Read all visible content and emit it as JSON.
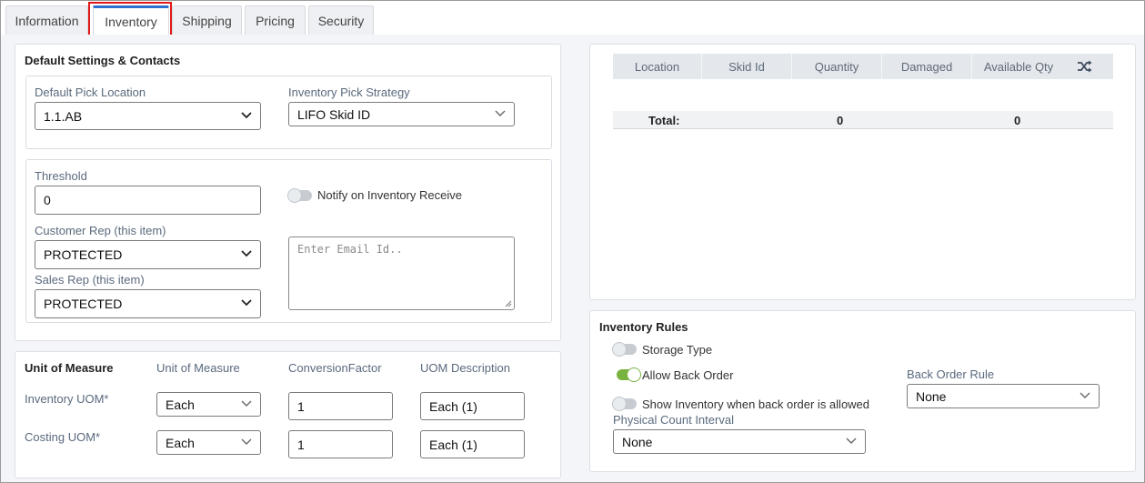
{
  "tabs": [
    {
      "label": "Information",
      "active": false
    },
    {
      "label": "Inventory",
      "active": true
    },
    {
      "label": "Shipping",
      "active": false
    },
    {
      "label": "Pricing",
      "active": false
    },
    {
      "label": "Security",
      "active": false
    }
  ],
  "defaults": {
    "title": "Default Settings & Contacts",
    "pick_location_label": "Default Pick Location",
    "pick_location_value": "1.1.AB",
    "pick_strategy_label": "Inventory Pick Strategy",
    "pick_strategy_value": "LIFO Skid ID",
    "threshold_label": "Threshold",
    "threshold_value": "0",
    "notify_label": "Notify on Inventory Receive",
    "notify_on": false,
    "customer_rep_label": "Customer Rep (this item)",
    "customer_rep_value": "PROTECTED",
    "sales_rep_label": "Sales Rep (this item)",
    "sales_rep_value": "PROTECTED",
    "email_placeholder": "Enter Email Id.."
  },
  "uom": {
    "title": "Unit of Measure",
    "col_unit": "Unit of Measure",
    "col_factor": "ConversionFactor",
    "col_desc": "UOM Description",
    "rows": [
      {
        "label": "Inventory UOM*",
        "unit": "Each",
        "factor": "1",
        "desc": "Each (1)"
      },
      {
        "label": "Costing UOM*",
        "unit": "Each",
        "factor": "1",
        "desc": "Each (1)"
      }
    ]
  },
  "stock_table": {
    "headers": [
      "Location",
      "Skid Id",
      "Quantity",
      "Damaged",
      "Available Qty"
    ],
    "shuffle_icon": "shuffle-icon",
    "total_label": "Total:",
    "total_quantity": "0",
    "total_available": "0"
  },
  "rules": {
    "title": "Inventory Rules",
    "storage_type_label": "Storage Type",
    "storage_type_on": false,
    "allow_back_order_label": "Allow Back Order",
    "allow_back_order_on": true,
    "show_inventory_label": "Show Inventory when back order is allowed",
    "show_inventory_on": false,
    "physical_count_label": "Physical Count Interval",
    "physical_count_value": "None",
    "back_order_rule_label": "Back Order Rule",
    "back_order_rule_value": "None"
  },
  "colors": {
    "active_tab_accent": "#2f6fd0",
    "highlight_box": "#e01919",
    "toggle_on": "#79b33f"
  }
}
